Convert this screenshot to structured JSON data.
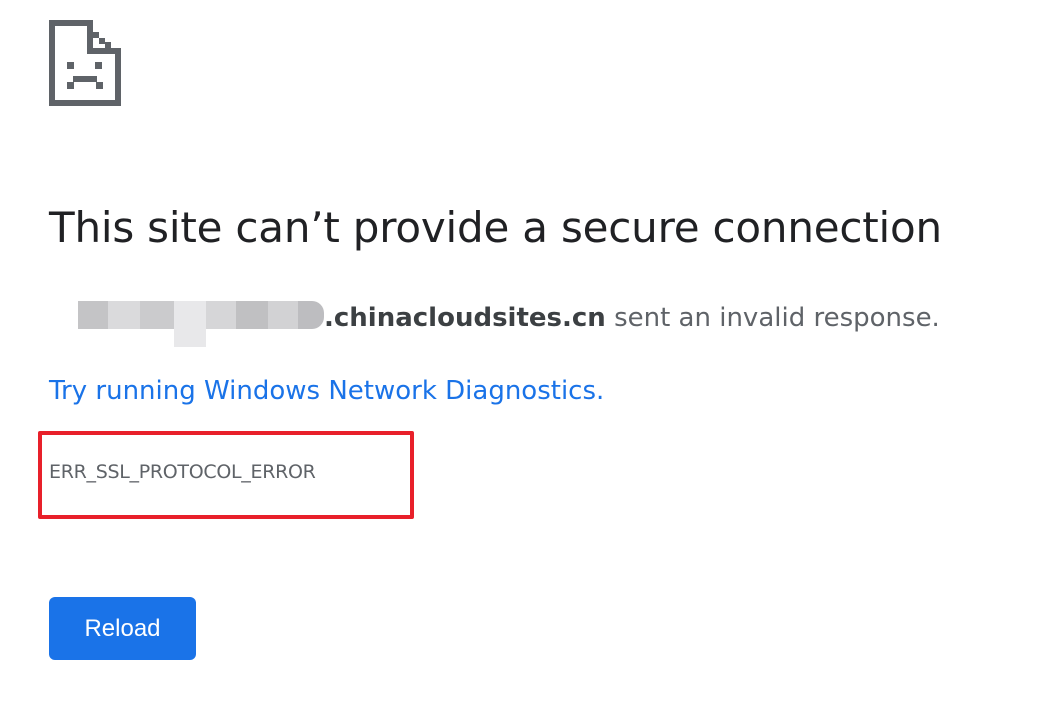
{
  "page": {
    "title": "This site can’t provide a secure connection",
    "summary": {
      "host": ".chinacloudsites.cn",
      "message": " sent an invalid response."
    },
    "diagnostics_link": "Try running Windows Network Diagnostics.",
    "error_code": "ERR_SSL_PROTOCOL_ERROR",
    "reload_label": "Reload"
  },
  "icons": {
    "error": "sad-page-icon"
  },
  "colors": {
    "title": "#202124",
    "body_text": "#5f6368",
    "link": "#1a73e8",
    "button": "#1a73e8",
    "highlight_box": "#e8202a"
  }
}
